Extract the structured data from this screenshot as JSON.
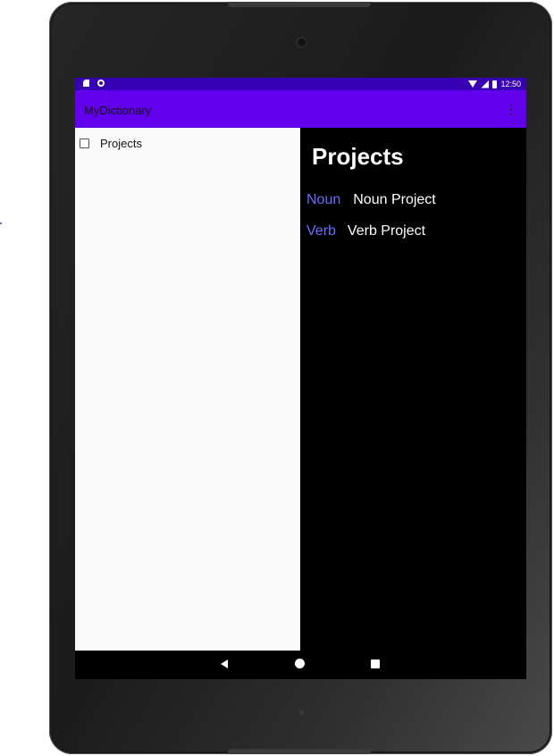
{
  "colors": {
    "status_bar": "#3700b3",
    "app_bar": "#6200ee",
    "accent": "#6b6bff",
    "nav_panel_bg": "#fafafa",
    "detail_bg": "#000000"
  },
  "status_bar": {
    "time": "12:50",
    "icons": [
      "sd-card-icon",
      "circle-icon",
      "wifi-icon",
      "signal-icon",
      "battery-icon"
    ]
  },
  "app_bar": {
    "title": "MyDictionary",
    "menu_icon": "overflow-menu-icon"
  },
  "nav_panel": {
    "items": [
      {
        "label": "Projects",
        "checked": false
      }
    ]
  },
  "detail": {
    "title": "Projects",
    "entries": [
      {
        "word": "Noun",
        "description": "Noun Project"
      },
      {
        "word": "Verb",
        "description": "Verb Project"
      }
    ]
  },
  "nav_bar": {
    "icons": [
      "back-icon",
      "home-icon",
      "recents-icon"
    ]
  }
}
